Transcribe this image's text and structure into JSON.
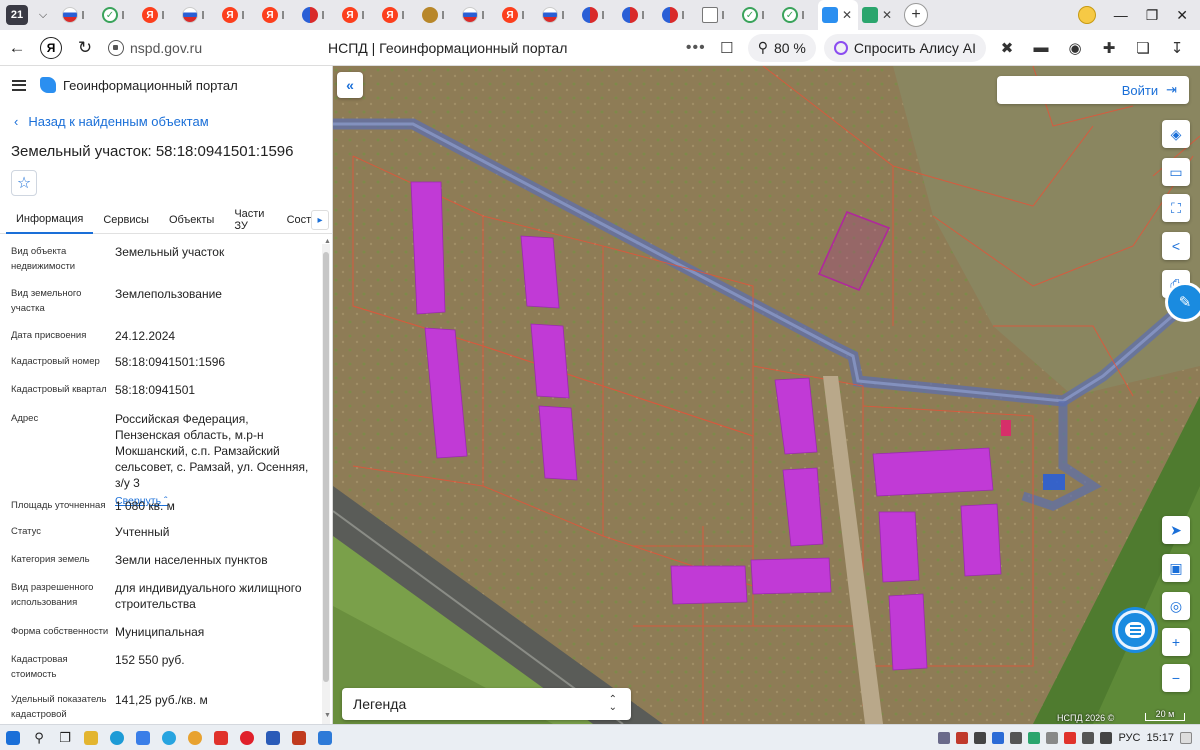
{
  "browser": {
    "tab_count": "21",
    "url": "nspd.gov.ru",
    "page_title": "НСПД | Геоинформационный портал",
    "zoom": "80 %",
    "alice_label": "Спросить Алису AI"
  },
  "panel": {
    "portal_name": "Геоинформационный портал",
    "back_label": "Назад к найденным объектам",
    "object_title": "Земельный участок: 58:18:0941501:1596",
    "tabs": [
      "Информация",
      "Сервисы",
      "Объекты",
      "Части ЗУ",
      "Состав"
    ],
    "collapse_label": "Свернуть",
    "attributes": [
      {
        "label": "Вид объекта недвижимости",
        "value": "Земельный участок"
      },
      {
        "label": "Вид земельного участка",
        "value": "Землепользование"
      },
      {
        "label": "Дата присвоения",
        "value": "24.12.2024"
      },
      {
        "label": "Кадастровый номер",
        "value": "58:18:0941501:1596"
      },
      {
        "label": "Кадастровый квартал",
        "value": "58:18:0941501"
      },
      {
        "label": "Адрес",
        "value": "Российская Федерация, Пензенская область, м.р-н Мокшанский, с.п. Рамзайский сельсовет, с. Рамзай, ул. Осенняя, з/у 3"
      },
      {
        "label": "Площадь уточненная",
        "value": "1 080 кв. м"
      },
      {
        "label": "Статус",
        "value": "Учтенный"
      },
      {
        "label": "Категория земель",
        "value": "Земли населенных пунктов"
      },
      {
        "label": "Вид разрешенного использования",
        "value": "для индивидуального жилищного строительства"
      },
      {
        "label": "Форма собственности",
        "value": "Муниципальная"
      },
      {
        "label": "Кадастровая стоимость",
        "value": "152 550 руб."
      },
      {
        "label": "Удельный показатель кадастровой",
        "value": "141,25 руб./кв. м"
      }
    ]
  },
  "map": {
    "login_label": "Войти",
    "legend_label": "Легенда",
    "copyright": "НСПД 2026 ©",
    "scale_label": "20 м",
    "colors": {
      "building": "#c13ad6",
      "selected_parcel": "#b0289c",
      "boundary": "#e2553a",
      "zone": "#5d6fae"
    }
  },
  "taskbar": {
    "language": "РУС",
    "time": "15:17"
  }
}
